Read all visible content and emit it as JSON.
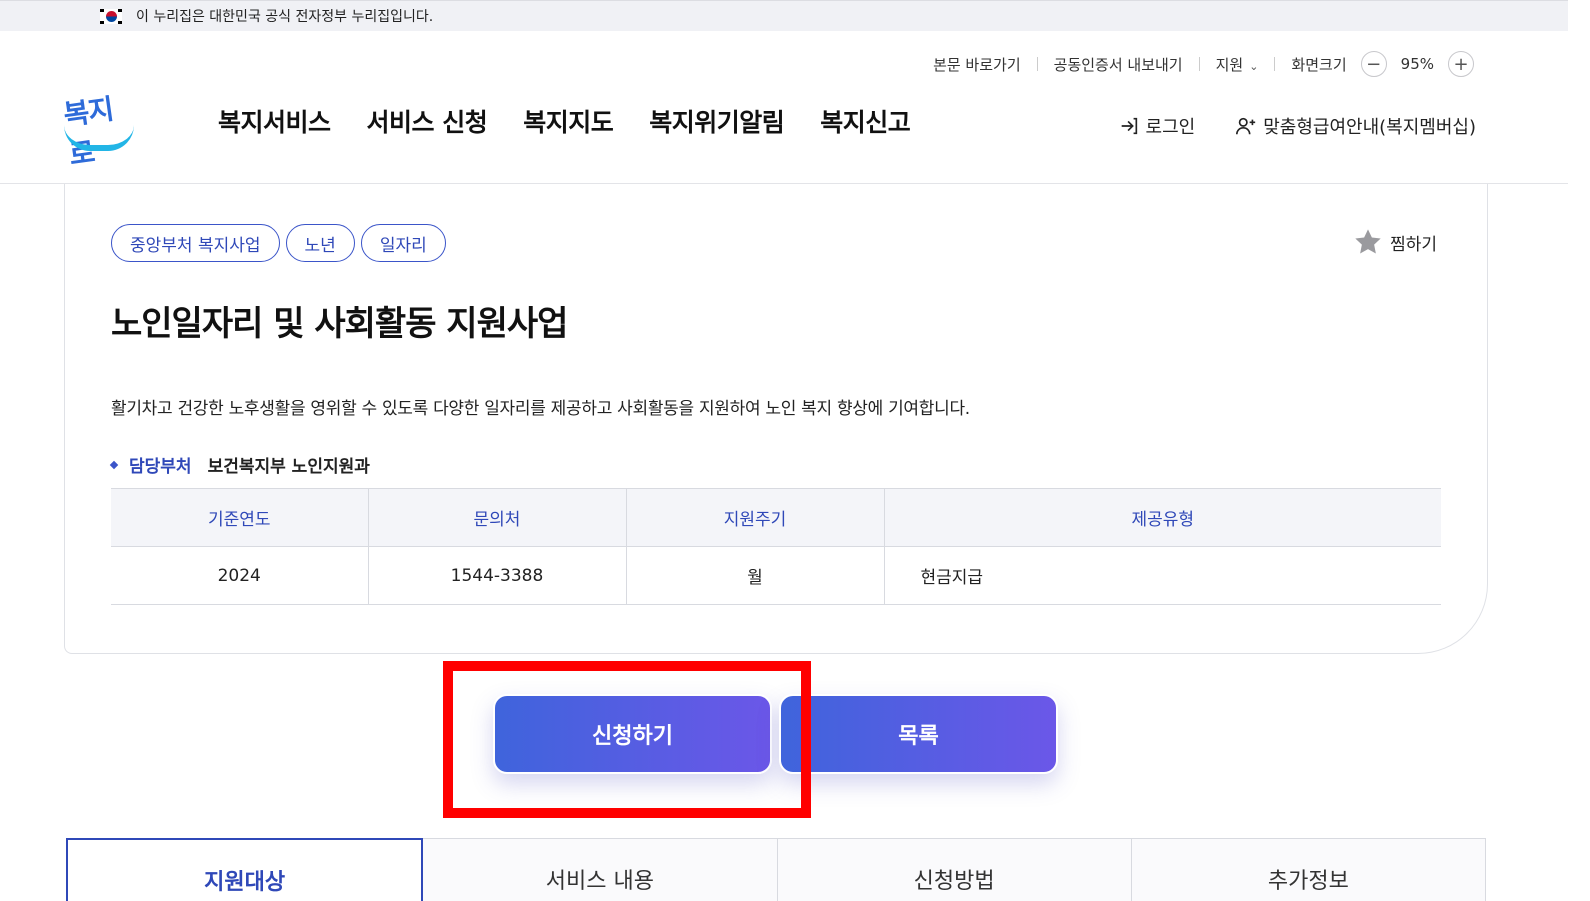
{
  "banner": {
    "text": "이 누리집은 대한민국 공식 전자정부 누리집입니다."
  },
  "util": {
    "skip": "본문 바로가기",
    "cert": "공동인증서 내보내기",
    "support": "지원",
    "zoom_label": "화면크기",
    "zoom_minus": "−",
    "zoom_value": "95%",
    "zoom_plus": "+"
  },
  "logo": {
    "text": "복지로"
  },
  "gnb": [
    "복지서비스",
    "서비스 신청",
    "복지지도",
    "복지위기알림",
    "복지신고"
  ],
  "member": {
    "login": "로그인",
    "membership": "맞춤형급여안내(복지멤버십)"
  },
  "detail": {
    "chips": [
      "중앙부처 복지사업",
      "노년",
      "일자리"
    ],
    "favorite": "찜하기",
    "title": "노인일자리 및 사회활동 지원사업",
    "description": "활기차고 건강한 노후생활을 영위할 수 있도록 다양한 일자리를 제공하고 사회활동을 지원하여 노인 복지 향상에 기여합니다.",
    "dept_label": "담당부처",
    "dept_value": "보건복지부 노인지원과",
    "table": {
      "headers": [
        "기준연도",
        "문의처",
        "지원주기",
        "제공유형"
      ],
      "row": [
        "2024",
        "1544-3388",
        "월",
        "현금지급"
      ]
    }
  },
  "buttons": {
    "apply": "신청하기",
    "list": "목록"
  },
  "tabs": [
    "지원대상",
    "서비스 내용",
    "신청방법",
    "추가정보"
  ],
  "colors": {
    "accent": "#2f48b8",
    "button_start": "#3f64dc",
    "button_end": "#6b57e8",
    "highlight": "#ff0000"
  }
}
